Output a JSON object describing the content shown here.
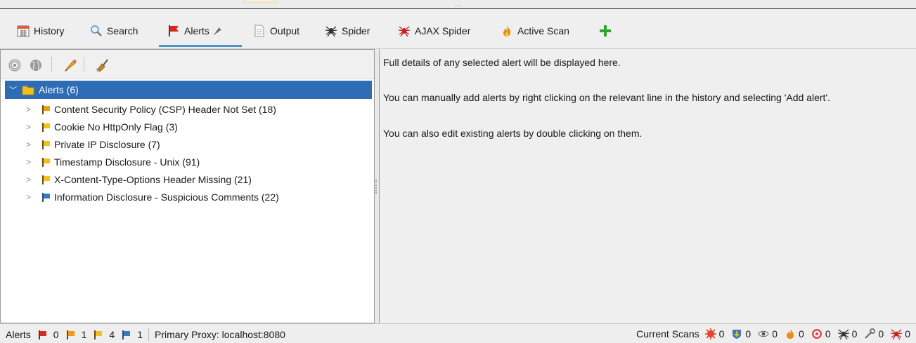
{
  "tabs": [
    {
      "label": "History",
      "icon": "calendar-icon"
    },
    {
      "label": "Search",
      "icon": "magnifier-icon"
    },
    {
      "label": "Alerts",
      "icon": "red-flag-icon",
      "pinned": true,
      "active": true
    },
    {
      "label": "Output",
      "icon": "document-icon"
    },
    {
      "label": "Spider",
      "icon": "spider-icon"
    },
    {
      "label": "AJAX Spider",
      "icon": "red-spider-icon"
    },
    {
      "label": "Active Scan",
      "icon": "flame-icon"
    }
  ],
  "add_tab_icon": "plus-icon",
  "alerts_toolbar": {
    "buttons": [
      "target-icon",
      "globe-icon",
      "pencil-icon",
      "broom-icon"
    ]
  },
  "tree": {
    "root_label": "Alerts (6)",
    "items": [
      {
        "label": "Content Security Policy (CSP) Header Not Set (18)",
        "risk": "medium"
      },
      {
        "label": "Cookie No HttpOnly Flag (3)",
        "risk": "low"
      },
      {
        "label": "Private IP Disclosure (7)",
        "risk": "low"
      },
      {
        "label": "Timestamp Disclosure - Unix (91)",
        "risk": "low"
      },
      {
        "label": "X-Content-Type-Options Header Missing (21)",
        "risk": "low"
      },
      {
        "label": "Information Disclosure - Suspicious Comments (22)",
        "risk": "informational"
      }
    ]
  },
  "details": {
    "line1": "Full details of any selected alert will be displayed here.",
    "line2": "You can manually add alerts by right clicking on the relevant line in the history and selecting 'Add alert'.",
    "line3": "You can also edit existing alerts by double clicking on them."
  },
  "status": {
    "alerts_label": "Alerts",
    "high": "0",
    "medium": "1",
    "low": "4",
    "info": "1",
    "proxy": "Primary Proxy: localhost:8080",
    "current_scans_label": "Current Scans",
    "scans": [
      {
        "icon": "scan-burst-icon",
        "count": "0"
      },
      {
        "icon": "download-shield-icon",
        "count": "0"
      },
      {
        "icon": "eye-icon",
        "count": "0"
      },
      {
        "icon": "flame-icon",
        "count": "0"
      },
      {
        "icon": "target-icon",
        "count": "0"
      },
      {
        "icon": "spider-icon",
        "count": "0"
      },
      {
        "icon": "wrench-icon",
        "count": "0"
      },
      {
        "icon": "red-spider-icon",
        "count": "0"
      }
    ]
  },
  "colors": {
    "selection": "#2d6db5",
    "high_flag": "#d42a1f",
    "medium_flag": "#f39c12",
    "low_flag": "#f2c21b",
    "info_flag": "#3a78c2",
    "active_tab_underline": "#4f92c8",
    "add_green": "#2fa32a"
  }
}
